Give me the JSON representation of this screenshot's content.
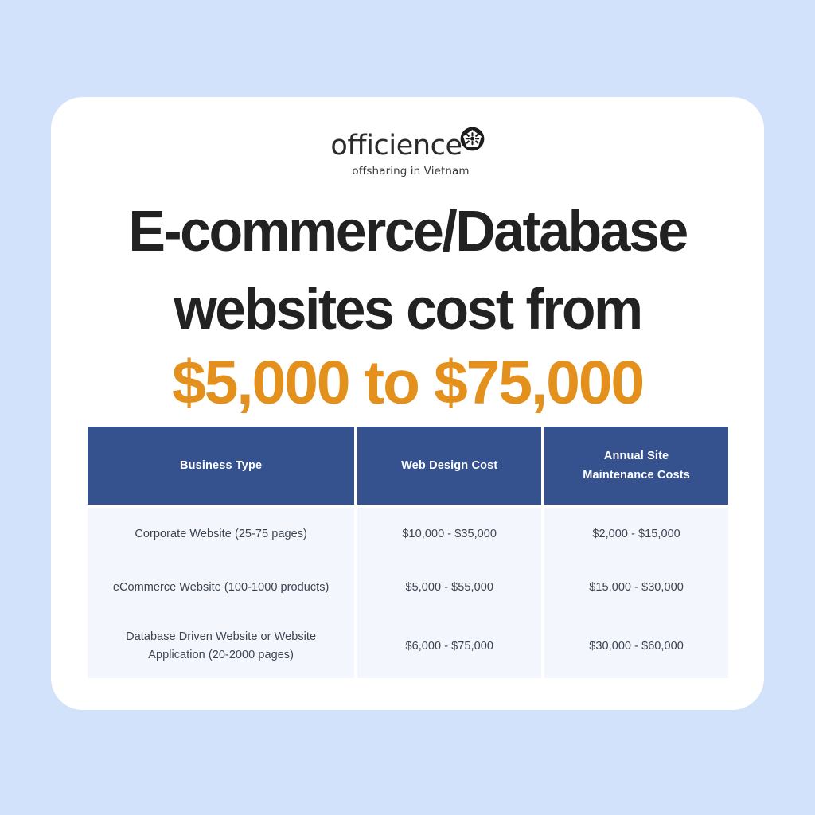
{
  "background_color": "#d3e2fb",
  "card": {
    "background_color": "#ffffff"
  },
  "brand": {
    "logo_wordmark": "officience",
    "logo_icon_name": "officience-pentagon-logo",
    "tagline": "offsharing in Vietnam"
  },
  "headline": {
    "line1": "E-commerce/Database",
    "line2": "websites cost from",
    "color": "#222222"
  },
  "price_highlight": {
    "text": "$5,000 to $75,000",
    "color": "#e3901c"
  },
  "table": {
    "header_background": "#35528f",
    "header_text_color": "#ffffff",
    "cell_background": "#f3f6fd",
    "cell_text_color": "#3c4450",
    "columns": [
      {
        "label": "Business Type"
      },
      {
        "label": "Web Design Cost"
      },
      {
        "label_line1": "Annual Site",
        "label_line2": "Maintenance Costs"
      }
    ],
    "rows": [
      {
        "business_type": "Corporate Website (25-75 pages)",
        "web_design_cost": "$10,000 - $35,000",
        "annual_maintenance_cost": "$2,000 - $15,000"
      },
      {
        "business_type": "eCommerce Website (100-1000 products)",
        "web_design_cost": "$5,000 - $55,000",
        "annual_maintenance_cost": "$15,000 - $30,000"
      },
      {
        "business_type_line1": "Database Driven Website or Website",
        "business_type_line2": "Application (20-2000 pages)",
        "web_design_cost": "$6,000 - $75,000",
        "annual_maintenance_cost": "$30,000 - $60,000"
      }
    ]
  }
}
